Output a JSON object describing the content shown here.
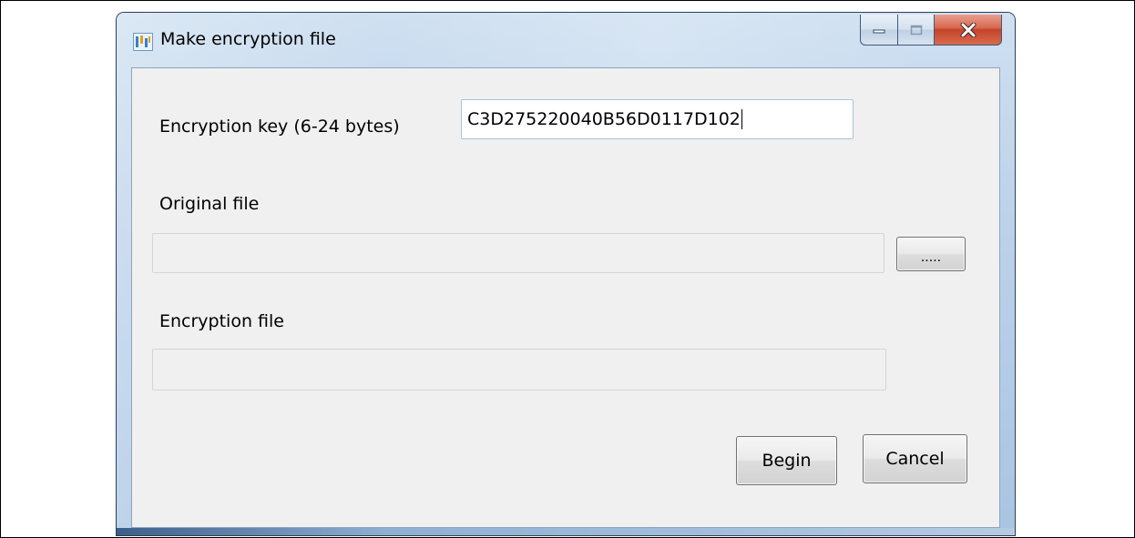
{
  "window": {
    "title": "Make encryption file",
    "app_icon": "app-icon",
    "caption_icons": {
      "minimize": "minimize-icon",
      "maximize": "maximize-icon",
      "close": "close-icon"
    },
    "close_color": "#c44327"
  },
  "form": {
    "key_label": "Encryption key (6-24 bytes)",
    "key_value": "C3D275220040B56D0117D102",
    "original_label": "Original file",
    "original_value": "",
    "browse_label": ".....",
    "encryption_label": "Encryption file",
    "encryption_value": ""
  },
  "buttons": {
    "begin": "Begin",
    "cancel": "Cancel"
  }
}
